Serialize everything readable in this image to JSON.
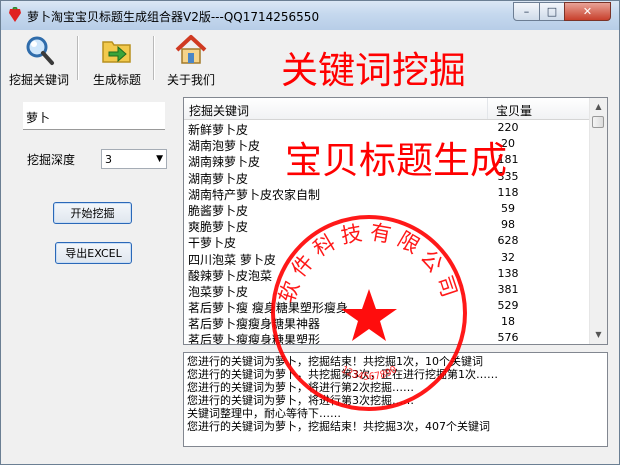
{
  "window": {
    "title": "萝卜淘宝宝贝标题生成组合器V2版---QQ1714256550"
  },
  "toolbar": {
    "items": [
      {
        "label": "挖掘关键词",
        "icon": "magnifier-icon"
      },
      {
        "label": "生成标题",
        "icon": "folder-arrow-icon"
      },
      {
        "label": "关于我们",
        "icon": "home-icon"
      }
    ]
  },
  "banner": {
    "line1": "关键词挖掘",
    "line2": "宝贝标题生成"
  },
  "form": {
    "keyword_value": "萝卜",
    "depth_label": "挖掘深度",
    "depth_value": "3",
    "start_button": "开始挖掘",
    "export_button": "导出EXCEL"
  },
  "table": {
    "headers": [
      "挖掘关键词",
      "宝贝量"
    ],
    "rows": [
      {
        "keyword": "新鲜萝卜皮",
        "count": "220"
      },
      {
        "keyword": "湖南泡萝卜皮",
        "count": "20"
      },
      {
        "keyword": "湖南辣萝卜皮",
        "count": "181"
      },
      {
        "keyword": "湖南萝卜皮",
        "count": "335"
      },
      {
        "keyword": "湖南特产萝卜皮农家自制",
        "count": "118"
      },
      {
        "keyword": "脆酱萝卜皮",
        "count": "59"
      },
      {
        "keyword": "爽脆萝卜皮",
        "count": "98"
      },
      {
        "keyword": "干萝卜皮",
        "count": "628"
      },
      {
        "keyword": "四川泡菜 萝卜皮",
        "count": "32"
      },
      {
        "keyword": "酸辣萝卜皮泡菜",
        "count": "138"
      },
      {
        "keyword": "泡菜萝卜皮",
        "count": "381"
      },
      {
        "keyword": "茗后萝卜瘦 瘦身糖果塑形瘦身",
        "count": "529"
      },
      {
        "keyword": "茗后萝卜瘦瘦身糖果神器",
        "count": "18"
      },
      {
        "keyword": "茗后萝卜瘦瘦身糖果塑形",
        "count": "576"
      }
    ]
  },
  "log": {
    "lines": [
      "您进行的关键词为萝卜，挖掘结束！共挖掘1次，10个关键词",
      "您进行的关键词为萝卜，共挖掘第3次，正在进行挖掘第1次……",
      "您进行的关键词为萝卜，将进行第2次挖掘……",
      "您进行的关键词为萝卜，将进行第3次挖掘……",
      "关键词整理中，耐心等待下……",
      "您进行的关键词为萝卜，挖掘结束！共挖掘3次，407个关键词"
    ]
  },
  "seal": {
    "text": "软件科技有限公司",
    "number": "1234567890"
  },
  "colors": {
    "banner": "#ff0000",
    "seal": "#ff0000"
  }
}
